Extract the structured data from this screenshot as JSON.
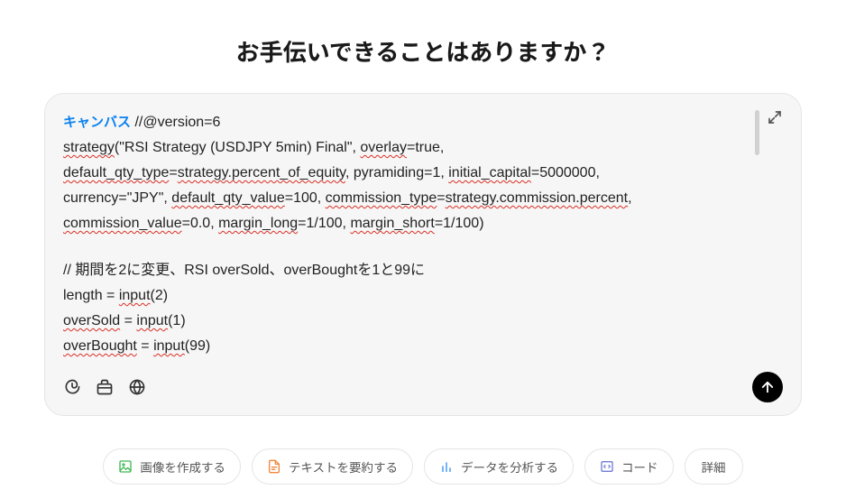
{
  "title": "お手伝いできることはありますか？",
  "canvas_label": "キャンバス",
  "code": {
    "line1_prefix": " //@version=6",
    "line2_seg1": "strategy",
    "line2_seg2": "(\"RSI Strategy (USDJPY 5min) Final\", ",
    "line2_seg3": "overlay",
    "line2_seg4": "=true,",
    "line3_seg1": "default_qty_type",
    "line3_seg2": "=",
    "line3_seg3": "strategy.percent_of_equity",
    "line3_seg4": ", pyramiding=1, ",
    "line3_seg5": "initial_capital",
    "line3_seg6": "=5000000,",
    "line4_seg1": "currency=\"JPY\", ",
    "line4_seg2": "default_qty_value",
    "line4_seg3": "=100, ",
    "line4_seg4": "commission_type",
    "line4_seg5": "=",
    "line4_seg6": "strategy.commission.percent",
    "line4_seg7": ",",
    "line5_seg1": "commission_value",
    "line5_seg2": "=0.0, ",
    "line5_seg3": "margin_long",
    "line5_seg4": "=1/100, ",
    "line5_seg5": "margin_short",
    "line5_seg6": "=1/100)",
    "line7": "// 期間を2に変更、RSI overSold、overBoughtを1と99に",
    "line8_seg1": "length = ",
    "line8_seg2": "input",
    "line8_seg3": "(2)",
    "line9_seg1": "overSold",
    "line9_seg2": " = ",
    "line9_seg3": "input",
    "line9_seg4": "(1)",
    "line10_seg1": "overBought",
    "line10_seg2": " = ",
    "line10_seg3": "input",
    "line10_seg4": "(99)"
  },
  "suggestions": {
    "create_image": "画像を作成する",
    "summarize": "テキストを要約する",
    "analyze": "データを分析する",
    "code": "コード",
    "more": "詳細"
  }
}
